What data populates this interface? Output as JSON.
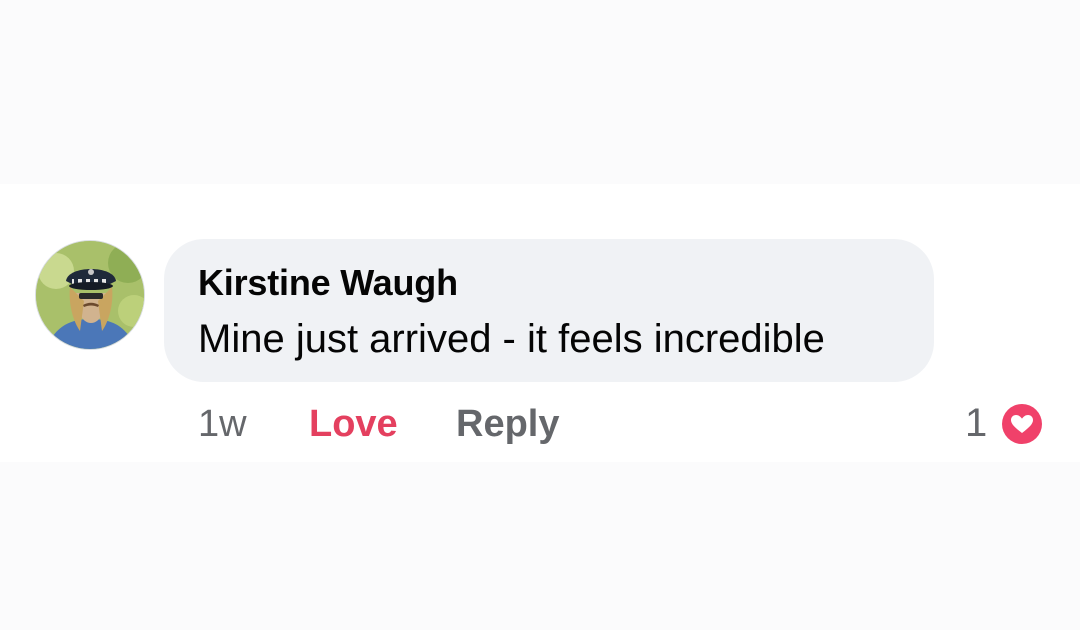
{
  "comment": {
    "author": "Kirstine Waugh",
    "text": "Mine just arrived - it feels incredible",
    "timestamp": "1w",
    "love_label": "Love",
    "reply_label": "Reply",
    "reaction_count": "1",
    "reaction_icon": "heart-icon"
  },
  "colors": {
    "love_active": "#e4405f",
    "bubble_bg": "#f0f2f5",
    "meta_text": "#65676b"
  }
}
